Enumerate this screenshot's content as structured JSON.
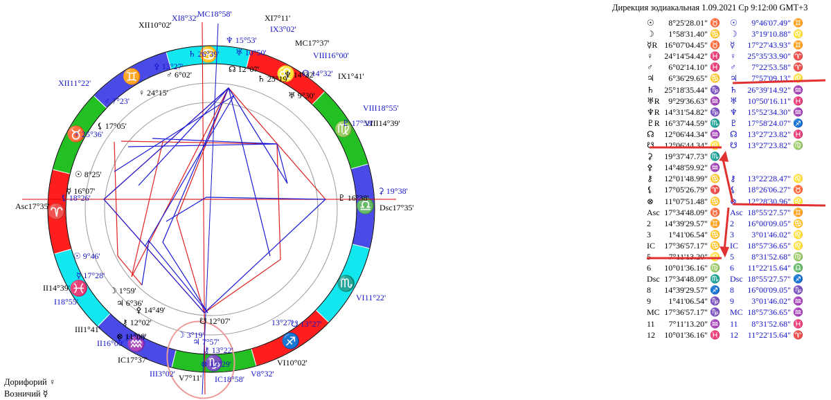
{
  "header": {
    "text": "Дирекция зодиакальная  1.09.2021  Ср  9:12:00 GMT+3"
  },
  "footer": [
    {
      "label": "Дорифорий",
      "glyph": "♀"
    },
    {
      "label": "Возничий",
      "glyph": "☿"
    }
  ],
  "table_left": [
    [
      "☉",
      "8°25'28.01\" ♉"
    ],
    [
      "☽",
      "1°58'31.40\" ♋"
    ],
    [
      "☿R",
      "16°07'04.45\" ♉"
    ],
    [
      "♀",
      "24°14'54.42\" ♓"
    ],
    [
      "♂",
      "6°02'14.10\" ♓"
    ],
    [
      "♃",
      "6°36'29.65\" ♋"
    ],
    [
      "♄",
      "25°18'35.44\" ♑"
    ],
    [
      "♅R",
      "9°29'36.63\" ♒"
    ],
    [
      "♆R",
      "14°31'54.82\" ♑"
    ],
    [
      "♇R",
      "16°37'44.59\" ♏"
    ],
    [
      "☊",
      "12°06'44.34\" ♒"
    ],
    [
      "☋",
      "12°06'44.34\" ♌"
    ],
    [
      "⚳",
      "19°37'47.73\" ♏"
    ],
    [
      "⚴",
      "14°48'59.92\" ♒"
    ],
    [
      "⚷",
      "12°01'48.99\" ♋"
    ],
    [
      "⚸",
      "17°05'26.79\" ♈"
    ],
    [
      "⊗",
      "11°07'51.48\" ♋"
    ],
    [
      "Asc",
      "17°34'48.09\" ♉"
    ],
    [
      "2",
      "14°39'29.57\" ♊"
    ],
    [
      "3",
      "1°41'06.54\" ♋"
    ],
    [
      "IC",
      "17°36'57.17\" ♋"
    ],
    [
      "5",
      "7°11'13.20\" ♌"
    ],
    [
      "6",
      "10°01'36.16\" ♍"
    ],
    [
      "Dsc",
      "17°34'48.09\" ♏"
    ],
    [
      "8",
      "14°39'29.57\" ♐"
    ],
    [
      "9",
      "1°41'06.54\" ♑"
    ],
    [
      "MC",
      "17°36'57.17\" ♑"
    ],
    [
      "11",
      "7°11'13.20\" ♒"
    ],
    [
      "12",
      "10°01'36.16\" ♓"
    ]
  ],
  "table_right": [
    [
      "☉",
      "9°46'07.49\" ♊"
    ],
    [
      "☽",
      "3°19'10.88\" ♌"
    ],
    [
      "☿",
      "17°27'43.93\" ♊"
    ],
    [
      "♀",
      "25°35'33.90\" ♈"
    ],
    [
      "♂",
      "7°22'53.58\" ♈"
    ],
    [
      "♃",
      "7°57'09.13\" ♌"
    ],
    [
      "♄",
      "26°39'14.92\" ♒"
    ],
    [
      "♅",
      "10°50'16.11\" ♓"
    ],
    [
      "♆",
      "15°52'34.30\" ♒"
    ],
    [
      "♇",
      "17°58'24.07\" ♐"
    ],
    [
      "☊",
      "13°27'23.82\" ♓"
    ],
    [
      "☋",
      "13°27'23.82\" ♍"
    ],
    [
      "",
      ""
    ],
    [
      "",
      ""
    ],
    [
      "⚷",
      "13°22'28.47\" ♌"
    ],
    [
      "⚸",
      "18°26'06.27\" ♉"
    ],
    [
      "⊗",
      "12°28'30.96\" ♌"
    ],
    [
      "Asc",
      "18°55'27.57\" ♊"
    ],
    [
      "2",
      "16°00'09.05\" ♋"
    ],
    [
      "3",
      "3°01'46.02\" ♌"
    ],
    [
      "IC",
      "18°57'36.65\" ♌"
    ],
    [
      "5",
      "8°31'52.68\" ♍"
    ],
    [
      "6",
      "11°22'15.64\" ♎"
    ],
    [
      "Dsc",
      "18°55'27.57\" ♐"
    ],
    [
      "8",
      "16°00'09.05\" ♑"
    ],
    [
      "9",
      "3°01'46.02\" ♒"
    ],
    [
      "MC",
      "18°57'36.65\" ♒"
    ],
    [
      "11",
      "8°31'52.68\" ♓"
    ],
    [
      "12",
      "11°22'15.64\" ♈"
    ]
  ],
  "wheel": {
    "signs": [
      {
        "glyph": "♈",
        "color": "#ff1e1e"
      },
      {
        "glyph": "♉",
        "color": "#22c022"
      },
      {
        "glyph": "♊",
        "color": "#4a4ae6"
      },
      {
        "glyph": "♋",
        "color": "#12e6ee"
      },
      {
        "glyph": "♌",
        "color": "#ff1e1e"
      },
      {
        "glyph": "♍",
        "color": "#22c022"
      },
      {
        "glyph": "♎",
        "color": "#4a4ae6"
      },
      {
        "glyph": "♏",
        "color": "#12e6ee"
      },
      {
        "glyph": "♐",
        "color": "#ff1e1e"
      },
      {
        "glyph": "♑",
        "color": "#22c022"
      },
      {
        "glyph": "♒",
        "color": "#4a4ae6"
      },
      {
        "glyph": "♓",
        "color": "#12e6ee"
      }
    ],
    "outer_labels": [
      {
        "t": "MC18°58'",
        "c": "blue"
      },
      {
        "t": "XI8°32'",
        "c": "blue"
      },
      {
        "t": "XII10°02'",
        "c": "black"
      },
      {
        "t": "XI7°11'",
        "c": "black"
      },
      {
        "t": "IX3°02'",
        "c": "blue"
      },
      {
        "t": "MC17°37'",
        "c": "black"
      },
      {
        "t": "VIII16°00'",
        "c": "blue"
      },
      {
        "t": "IX1°41'",
        "c": "black"
      },
      {
        "t": "XII11°22'",
        "c": "blue"
      },
      {
        "t": "VIII18°55'",
        "c": "blue"
      },
      {
        "t": "VIII14°39'",
        "c": "black"
      },
      {
        "t": "Asc17°35'",
        "c": "black"
      },
      {
        "t": "Dsc17°35'",
        "c": "black"
      },
      {
        "t": "II14°39'",
        "c": "black"
      },
      {
        "t": "I18°55'",
        "c": "blue"
      },
      {
        "t": "VI11°22'",
        "c": "blue"
      },
      {
        "t": "III1°41'",
        "c": "black"
      },
      {
        "t": "II16°00'",
        "c": "blue"
      },
      {
        "t": "IC17°37'",
        "c": "black"
      },
      {
        "t": "III3°02'",
        "c": "blue"
      },
      {
        "t": "V7°11'",
        "c": "black"
      },
      {
        "t": "IC18°58'",
        "c": "blue"
      },
      {
        "t": "V8°32'",
        "c": "blue"
      },
      {
        "t": "VI10°02'",
        "c": "black"
      }
    ],
    "outer_planets": [
      {
        "t": "15°53'",
        "g": "♆"
      },
      {
        "t": "10°50'",
        "g": "♅"
      },
      {
        "t": "26°39'",
        "g": "♄"
      },
      {
        "t": "14°32'",
        "g": "☊"
      },
      {
        "t": "13°27'",
        "g": "⚴"
      },
      {
        "t": "7°23'",
        "g": "♂"
      },
      {
        "t": "25°36'",
        "g": "♀"
      },
      {
        "t": "17°58'",
        "g": "♇"
      },
      {
        "t": "18°26'",
        "g": "⚸"
      },
      {
        "t": "9°46'",
        "g": "☉"
      },
      {
        "t": "17°28'",
        "g": "☿"
      },
      {
        "t": "19°38'",
        "g": "⚳"
      },
      {
        "t": "13°27'",
        "g": "☋"
      },
      {
        "t": "3°19'",
        "g": "☽"
      },
      {
        "t": "7°57'",
        "g": "♃"
      },
      {
        "t": "13°22'",
        "g": "⚷"
      },
      {
        "t": "12°29'",
        "g": "⊗"
      },
      {
        "t": "18°08'",
        "g": "⚸"
      }
    ],
    "inner_planets": [
      {
        "t": "6°02'",
        "g": "♂"
      },
      {
        "t": "12°07'",
        "g": "☊"
      },
      {
        "t": "25°19'",
        "g": "♄"
      },
      {
        "t": "14°32'",
        "g": "♆"
      },
      {
        "t": "9°30'",
        "g": "♅"
      },
      {
        "t": "24°15'",
        "g": "♀"
      },
      {
        "t": "17°05'",
        "g": "⚸"
      },
      {
        "t": "8°25'",
        "g": "☉"
      },
      {
        "t": "16°07'",
        "g": "☿"
      },
      {
        "t": "16°38'",
        "g": "♇"
      },
      {
        "t": "1°59'",
        "g": "☽"
      },
      {
        "t": "6°36'",
        "g": "♃"
      },
      {
        "t": "14°49'",
        "g": "⚴"
      },
      {
        "t": "12°02'",
        "g": "⚷"
      },
      {
        "t": "11°08'",
        "g": "⊗"
      },
      {
        "t": "12°07'",
        "g": "☋"
      },
      {
        "t": "13°27'",
        "g": ""
      }
    ]
  }
}
